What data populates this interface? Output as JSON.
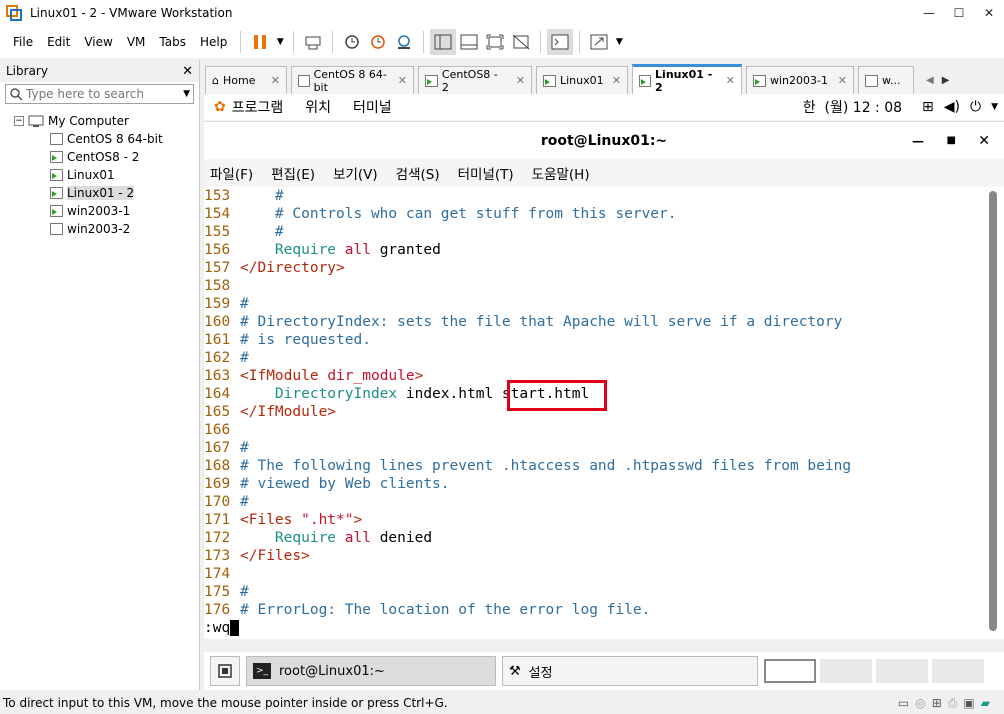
{
  "window": {
    "title": "Linux01 - 2 - VMware Workstation"
  },
  "menu": [
    "File",
    "Edit",
    "View",
    "VM",
    "Tabs",
    "Help"
  ],
  "library": {
    "title": "Library",
    "search_placeholder": "Type here to search",
    "root": "My Computer",
    "items": [
      {
        "label": "CentOS 8 64-bit",
        "running": false
      },
      {
        "label": "CentOS8 - 2",
        "running": true
      },
      {
        "label": "Linux01",
        "running": true
      },
      {
        "label": "Linux01 - 2",
        "running": true,
        "selected": true
      },
      {
        "label": "win2003-1",
        "running": true
      },
      {
        "label": "win2003-2",
        "running": false
      }
    ]
  },
  "tabs": [
    {
      "label": "Home"
    },
    {
      "label": "CentOS 8 64-bit"
    },
    {
      "label": "CentOS8 - 2"
    },
    {
      "label": "Linux01"
    },
    {
      "label": "Linux01 - 2",
      "active": true
    },
    {
      "label": "win2003-1"
    },
    {
      "label": "w..."
    }
  ],
  "gnome": {
    "programs": "프로그램",
    "places": "위치",
    "terminal": "터미널",
    "clock": "한  (월) 12 : 08"
  },
  "terminal": {
    "title": "root@Linux01:~",
    "menu": [
      "파일(F)",
      "편집(E)",
      "보기(V)",
      "검색(S)",
      "터미널(T)",
      "도움말(H)"
    ]
  },
  "editor": {
    "lines": [
      {
        "n": "153",
        "t": "    #",
        "c": "cm"
      },
      {
        "n": "154",
        "t": "    # Controls who can get stuff from this server.",
        "c": "cm"
      },
      {
        "n": "155",
        "t": "    #",
        "c": "cm"
      },
      {
        "n": "156",
        "t": "    Require all granted",
        "c": "req"
      },
      {
        "n": "157",
        "t": "</Directory>",
        "c": "tag"
      },
      {
        "n": "158",
        "t": "",
        "c": ""
      },
      {
        "n": "159",
        "t": "#",
        "c": "cm"
      },
      {
        "n": "160",
        "t": "# DirectoryIndex: sets the file that Apache will serve if a directory",
        "c": "cm"
      },
      {
        "n": "161",
        "t": "# is requested.",
        "c": "cm"
      },
      {
        "n": "162",
        "t": "#",
        "c": "cm"
      },
      {
        "n": "163",
        "t": "<IfModule dir_module>",
        "c": "tagmod"
      },
      {
        "n": "164",
        "t": "    DirectoryIndex index.html start.html",
        "c": "dirindex"
      },
      {
        "n": "165",
        "t": "</IfModule>",
        "c": "tag"
      },
      {
        "n": "166",
        "t": "",
        "c": ""
      },
      {
        "n": "167",
        "t": "#",
        "c": "cm"
      },
      {
        "n": "168",
        "t": "# The following lines prevent .htaccess and .htpasswd files from being",
        "c": "cm"
      },
      {
        "n": "169",
        "t": "# viewed by Web clients.",
        "c": "cm"
      },
      {
        "n": "170",
        "t": "#",
        "c": "cm"
      },
      {
        "n": "171",
        "t": "<Files \".ht*\">",
        "c": "files"
      },
      {
        "n": "172",
        "t": "    Require all denied",
        "c": "req"
      },
      {
        "n": "173",
        "t": "</Files>",
        "c": "tag"
      },
      {
        "n": "174",
        "t": "",
        "c": ""
      },
      {
        "n": "175",
        "t": "#",
        "c": "cm"
      },
      {
        "n": "176",
        "t": "# ErrorLog: The location of the error log file.",
        "c": "cm"
      }
    ],
    "command": ":wq"
  },
  "taskbar": {
    "terminal": "root@Linux01:~",
    "settings": "설정"
  },
  "status": "To direct input to this VM, move the mouse pointer inside or press Ctrl+G."
}
